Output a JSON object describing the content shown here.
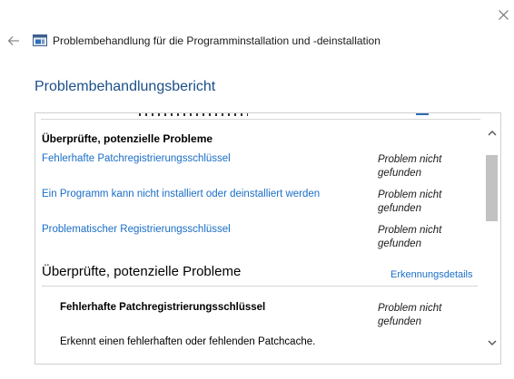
{
  "window": {
    "title": "Problembehandlung für die Programminstallation und -deinstallation",
    "close_icon": "close-icon",
    "back_icon": "back-arrow-icon",
    "app_icon": "troubleshooter-app-icon"
  },
  "page": {
    "heading": "Problembehandlungsbericht"
  },
  "report": {
    "summary_section": {
      "title": "Überprüfte, potenzielle Probleme",
      "issues": [
        {
          "name": "Fehlerhafte Patchregistrierungsschlüssel",
          "status_line1": "Problem nicht",
          "status_line2": "gefunden"
        },
        {
          "name": "Ein Programm kann nicht installiert oder deinstalliert werden",
          "status_line1": "Problem nicht",
          "status_line2": "gefunden"
        },
        {
          "name": "Problematischer Registrierungsschlüssel",
          "status_line1": "Problem nicht",
          "status_line2": "gefunden"
        }
      ]
    },
    "details_section": {
      "title": "Überprüfte, potenzielle Probleme",
      "details_link": "Erkennungsdetails",
      "issue": {
        "name": "Fehlerhafte Patchregistrierungsschlüssel",
        "status_line1": "Problem nicht",
        "status_line2": "gefunden",
        "description": "Erkennt einen fehlerhaften oder fehlenden Patchcache."
      }
    }
  },
  "scrollbar": {
    "up_icon": "chevron-up-icon",
    "down_icon": "chevron-down-icon"
  },
  "colors": {
    "heading": "#1b4f8a",
    "link": "#1a6ec7",
    "scroll_thumb": "#c2c2c2",
    "border": "#cfcfcf"
  }
}
